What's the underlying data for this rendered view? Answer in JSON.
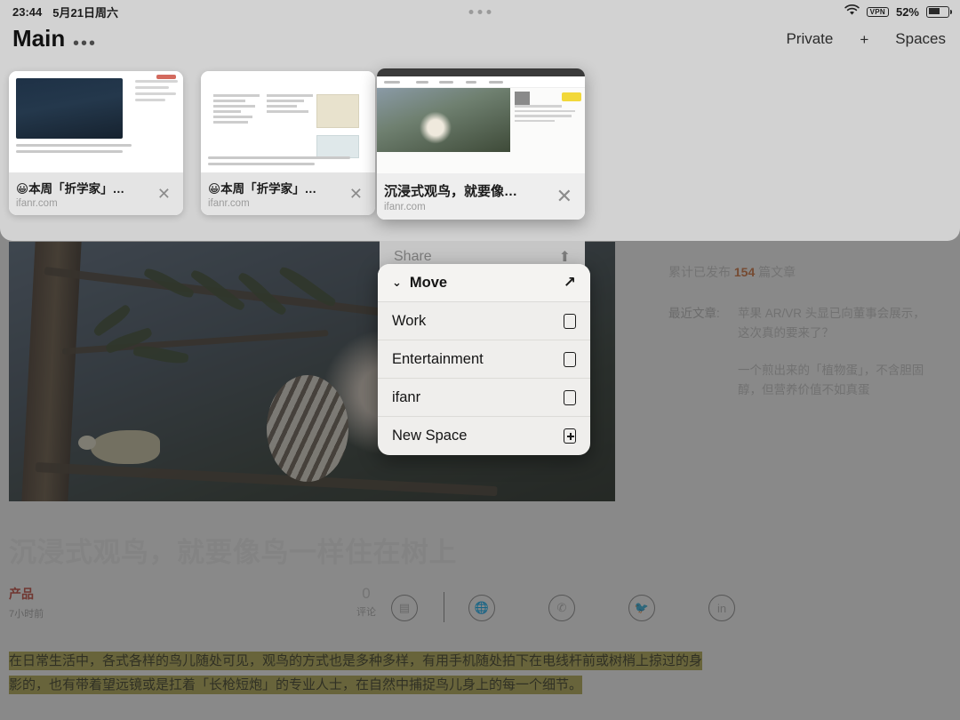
{
  "statusbar": {
    "time": "23:44",
    "date": "5月21日周六",
    "wifi_icon": "wifi-icon",
    "vpn_label": "VPN",
    "battery_percent": "52%"
  },
  "toolbar": {
    "title": "Main",
    "more_label": "•••",
    "private_label": "Private",
    "new_tab_label": "+",
    "spaces_label": "Spaces"
  },
  "tabs": [
    {
      "title": "😀本周「折学家」…",
      "url": "ifanr.com",
      "close_label": "✕",
      "active": false
    },
    {
      "title": "😀本周「折学家」…",
      "url": "ifanr.com",
      "close_label": "✕",
      "active": false
    },
    {
      "title": "沉浸式观鸟，就要像…",
      "url": "ifanr.com",
      "close_label": "✕",
      "active": true
    }
  ],
  "context_menu": {
    "share_label": "Share",
    "share_icon": "share-icon",
    "move_label": "Move",
    "move_icon": "arrow-forward-icon",
    "move_chevron": "⌄",
    "items": [
      {
        "label": "Work",
        "icon": "square-icon"
      },
      {
        "label": "Entertainment",
        "icon": "square-icon"
      },
      {
        "label": "ifanr",
        "icon": "square-icon"
      },
      {
        "label": "New Space",
        "icon": "plus-square-icon"
      }
    ]
  },
  "article": {
    "headline": "沉浸式观鸟，就要像鸟一样住在树上",
    "category": "产品",
    "category_color": "#c8493c",
    "time_ago": "7小时前",
    "comment_count": "0",
    "comment_label": "评论",
    "share_buttons": [
      "comment-icon",
      "weibo-icon",
      "wechat-icon",
      "twitter-icon",
      "linkedin-icon"
    ],
    "body_paragraph": "在日常生活中，各式各样的鸟儿随处可见，观鸟的方式也是多种多样，有用手机随处拍下在电线杆前或树梢上掠过的身影的，也有带着望远镜或是扛着「长枪短炮」的专业人士，在自然中捕捉鸟儿身上的每一个细节。",
    "highlight_color": "#b5ae52"
  },
  "sidebar": {
    "stat_prefix": "累计已发布",
    "stat_count": "154",
    "stat_suffix": "篇文章",
    "recent_label": "最近文章:",
    "recent_articles": [
      "苹果 AR/VR 头显已向董事会展示，这次真的要来了？",
      "一个煎出来的「植物蛋」，不含胆固醇，但营养价值不如真蛋"
    ]
  }
}
